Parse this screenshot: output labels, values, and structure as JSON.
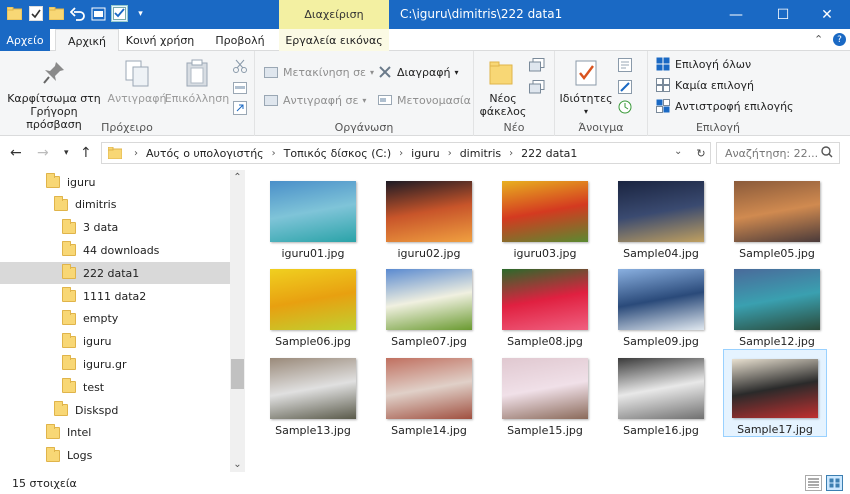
{
  "titlebar": {
    "context_tab": "Διαχείριση",
    "title": "C:\\iguru\\dimitris\\222 data1",
    "minimize_glyph": "—",
    "maximize_glyph": "☐",
    "close_glyph": "✕"
  },
  "tabs": {
    "file": "Αρχείο",
    "home": "Αρχική",
    "share": "Κοινή χρήση",
    "view": "Προβολή",
    "picture_tools": "Εργαλεία εικόνας",
    "collapse_glyph": "⌃",
    "help_glyph": "?"
  },
  "ribbon": {
    "clipboard": {
      "label": "Πρόχειρο",
      "pin_line1": "Καρφίτσωμα στη",
      "pin_line2": "Γρήγορη πρόσβαση",
      "copy": "Αντιγραφή",
      "paste": "Επικόλληση"
    },
    "organize": {
      "label": "Οργάνωση",
      "move_to": "Μετακίνηση σε",
      "copy_to": "Αντιγραφή σε",
      "delete": "Διαγραφή",
      "rename": "Μετονομασία"
    },
    "new": {
      "label": "Νέο",
      "new_folder_line1": "Νέος",
      "new_folder_line2": "φάκελος"
    },
    "open": {
      "label": "Άνοιγμα",
      "properties": "Ιδιότητες"
    },
    "select": {
      "label": "Επιλογή",
      "select_all": "Επιλογή όλων",
      "select_none": "Καμία επιλογή",
      "invert": "Αντιστροφή επιλογής"
    }
  },
  "address": {
    "crumbs": [
      "Αυτός ο υπολογιστής",
      "Τοπικός δίσκος (C:)",
      "iguru",
      "dimitris",
      "222 data1"
    ],
    "search_placeholder": "Αναζήτηση: 22..."
  },
  "nav": {
    "items": [
      {
        "label": "iguru",
        "selected": false
      },
      {
        "label": "dimitris",
        "selected": false
      },
      {
        "label": "3 data",
        "selected": false
      },
      {
        "label": "44 downloads",
        "selected": false
      },
      {
        "label": "222 data1",
        "selected": true
      },
      {
        "label": "1111 data2",
        "selected": false
      },
      {
        "label": "empty",
        "selected": false
      },
      {
        "label": "iguru",
        "selected": false
      },
      {
        "label": "iguru.gr",
        "selected": false
      },
      {
        "label": "test",
        "selected": false
      },
      {
        "label": "Diskspd",
        "selected": false
      },
      {
        "label": "Intel",
        "selected": false
      },
      {
        "label": "Logs",
        "selected": false
      }
    ]
  },
  "files": [
    {
      "name": "iguru01.jpg",
      "colors": [
        "#4a8fc9",
        "#7fc4d8",
        "#2aa3a8"
      ]
    },
    {
      "name": "iguru02.jpg",
      "colors": [
        "#1c1a24",
        "#c8552a",
        "#f0a040"
      ]
    },
    {
      "name": "iguru03.jpg",
      "colors": [
        "#e8b020",
        "#d43a20",
        "#5a8a30"
      ]
    },
    {
      "name": "Sample04.jpg",
      "colors": [
        "#1a2440",
        "#3a4a70",
        "#c0a060"
      ]
    },
    {
      "name": "Sample05.jpg",
      "colors": [
        "#8a5a3a",
        "#d08a50",
        "#4a3a3a"
      ]
    },
    {
      "name": "Sample06.jpg",
      "colors": [
        "#f0d020",
        "#e8a010",
        "#c0d030"
      ]
    },
    {
      "name": "Sample07.jpg",
      "colors": [
        "#5a8ad0",
        "#f0f0e0",
        "#6a9a30"
      ]
    },
    {
      "name": "Sample08.jpg",
      "colors": [
        "#2a6a2a",
        "#e02040",
        "#f06080"
      ]
    },
    {
      "name": "Sample09.jpg",
      "colors": [
        "#8ab0e0",
        "#2a4a7a",
        "#e0e8f0"
      ]
    },
    {
      "name": "Sample12.jpg",
      "colors": [
        "#4a6a9a",
        "#3aa0b0",
        "#2a4a3a"
      ]
    },
    {
      "name": "Sample13.jpg",
      "colors": [
        "#9a8a7a",
        "#e0e0e0",
        "#5a5a4a"
      ]
    },
    {
      "name": "Sample14.jpg",
      "colors": [
        "#c07060",
        "#e0d0c8",
        "#a05040"
      ]
    },
    {
      "name": "Sample15.jpg",
      "colors": [
        "#e0c8d0",
        "#f0e0e8",
        "#8a6a5a"
      ]
    },
    {
      "name": "Sample16.jpg",
      "colors": [
        "#3a3a3a",
        "#e8e8e8",
        "#707070"
      ]
    },
    {
      "name": "Sample17.jpg",
      "colors": [
        "#e8e0d0",
        "#2a2a2a",
        "#c03030"
      ]
    }
  ],
  "selected_file_index": 14,
  "status": {
    "count": "15 στοιχεία"
  },
  "colors": {
    "accent": "#1a69c4",
    "context_tab": "#f3f0a2",
    "folder": "#f8d775"
  }
}
